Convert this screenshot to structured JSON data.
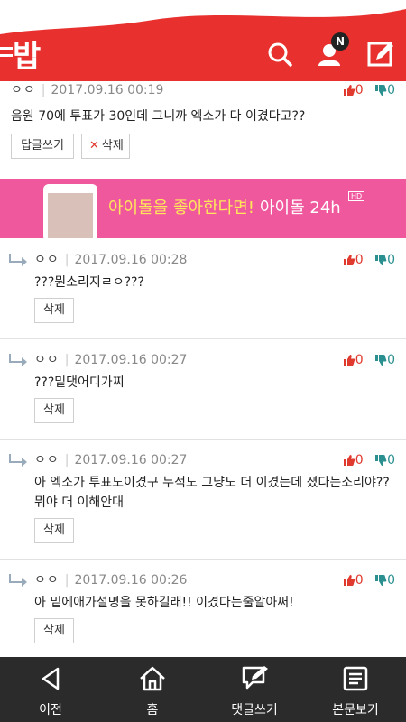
{
  "header": {
    "logo_text": "밥",
    "notification_badge": "N",
    "colors": {
      "brand": "#e8312f"
    }
  },
  "comments": [
    {
      "author": "ㅇㅇ",
      "date": "2017.09.16 00:19",
      "text": "음원 70에 투표가 30인데 그니까 엑소가 다 이겼다고??",
      "likes": "0",
      "dislikes": "0",
      "reply_btn": "답글쓰기",
      "delete_btn": "삭제"
    },
    {
      "author": "ㅇㅇ",
      "date": "2017.09.16 00:28",
      "text": "???뭔소리지ㄹㅇ???",
      "likes": "0",
      "dislikes": "0",
      "delete_btn": "삭제"
    },
    {
      "author": "ㅇㅇ",
      "date": "2017.09.16 00:27",
      "text": "???밑댓어디가찌",
      "likes": "0",
      "dislikes": "0",
      "delete_btn": "삭제"
    },
    {
      "author": "ㅇㅇ",
      "date": "2017.09.16 00:27",
      "text": "아 엑소가 투표도이겼구 누적도 그냥도 더 이겼는데 졌다는소리야?? 뭐야 더 이해안대",
      "likes": "0",
      "dislikes": "0",
      "delete_btn": "삭제"
    },
    {
      "author": "ㅇㅇ",
      "date": "2017.09.16 00:26",
      "text": "아 밑에애가설명을 못하길래!! 이겼다는줄알아써!",
      "likes": "0",
      "dislikes": "0",
      "delete_btn": "삭제"
    }
  ],
  "banner": {
    "text_highlight": "아이돌을 좋아한다면!",
    "text_main": "아이돌 24h",
    "hd_badge": "HD"
  },
  "bottom_nav": {
    "prev": "이전",
    "home": "홈",
    "write_comment": "댓글쓰기",
    "view_article": "본문보기"
  }
}
